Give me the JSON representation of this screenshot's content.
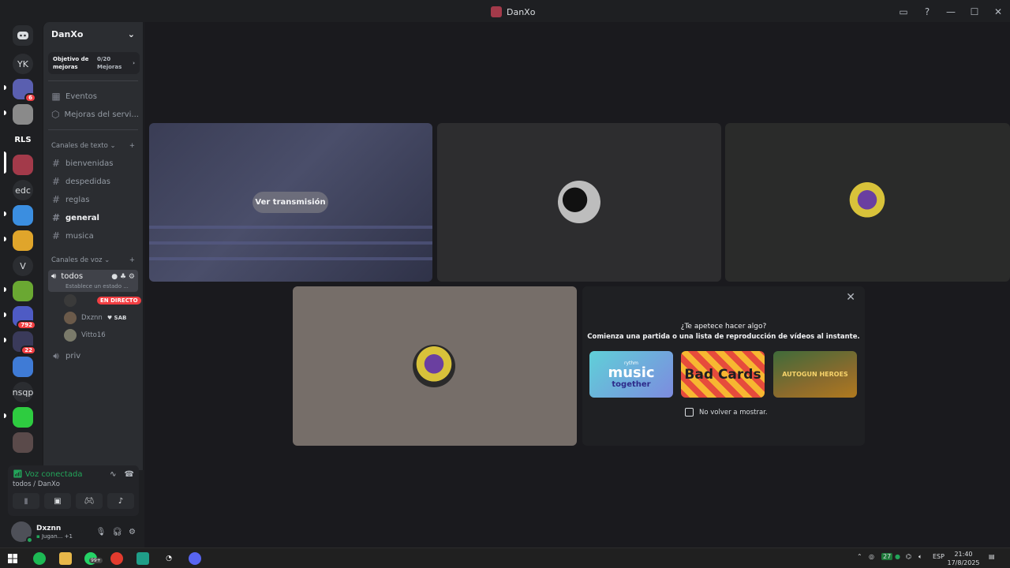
{
  "window": {
    "title": "DanXo"
  },
  "rail": {
    "items": [
      {
        "label": "YK"
      },
      {
        "label": "RLS"
      },
      {
        "label": "edc"
      },
      {
        "label": "V"
      },
      {
        "label": "nsqp"
      }
    ],
    "badges": [
      "6",
      "792",
      "22"
    ]
  },
  "sidebar": {
    "guild_name": "DanXo",
    "boost_goal": {
      "label": "Objetivo de mejoras",
      "count": "0/20",
      "unit": "Mejoras"
    },
    "top_items": [
      {
        "label": "Eventos",
        "icon": "calendar-icon"
      },
      {
        "label": "Mejoras del servi...",
        "icon": "boost-shield-icon"
      }
    ],
    "text_category": "Canales de texto",
    "text_channels": [
      {
        "label": "bienvenidas"
      },
      {
        "label": "despedidas"
      },
      {
        "label": "reglas"
      },
      {
        "label": "general",
        "active": true
      },
      {
        "label": "musica"
      }
    ],
    "voice_category": "Canales de voz",
    "voice_channel": {
      "label": "todos",
      "status": "Establece un estado ..."
    },
    "voice_users": [
      {
        "name": "",
        "tag": "EN DIRECTO"
      },
      {
        "name": "Dxznn",
        "tag": "SAB"
      },
      {
        "name": "Vitto16",
        "tag": ""
      }
    ],
    "other_voice": {
      "label": "priv"
    }
  },
  "voice_panel": {
    "status": "Voz conectada",
    "location": "todos / DanXo"
  },
  "user_panel": {
    "name": "Dxznn",
    "activity": "Jugan...",
    "extra": "+1"
  },
  "stage": {
    "watch_button": "Ver transmisión",
    "activity_prompt": {
      "question": "¿Te apetece hacer algo?",
      "subtitle": "Comienza una partida o una lista de reproducción de vídeos al instante.",
      "cards": [
        {
          "name": "rythm music together",
          "brand": "rythm",
          "big": "music",
          "mid": "together"
        },
        {
          "name": "Bad Cards",
          "big": "Bad Cards"
        },
        {
          "name": "Autogun Heroes",
          "big": "AUTOGUN HEROES"
        }
      ],
      "checkbox_label": "No volver a mostrar."
    }
  },
  "taskbar": {
    "whatsapp_badge": "99+",
    "tray_num": "27",
    "language": "ESP",
    "time": "21:40",
    "date": "17/8/2025"
  },
  "colors": {
    "accent_green": "#23a55a",
    "live_red": "#f23f43",
    "bg": "#1e1f22"
  }
}
